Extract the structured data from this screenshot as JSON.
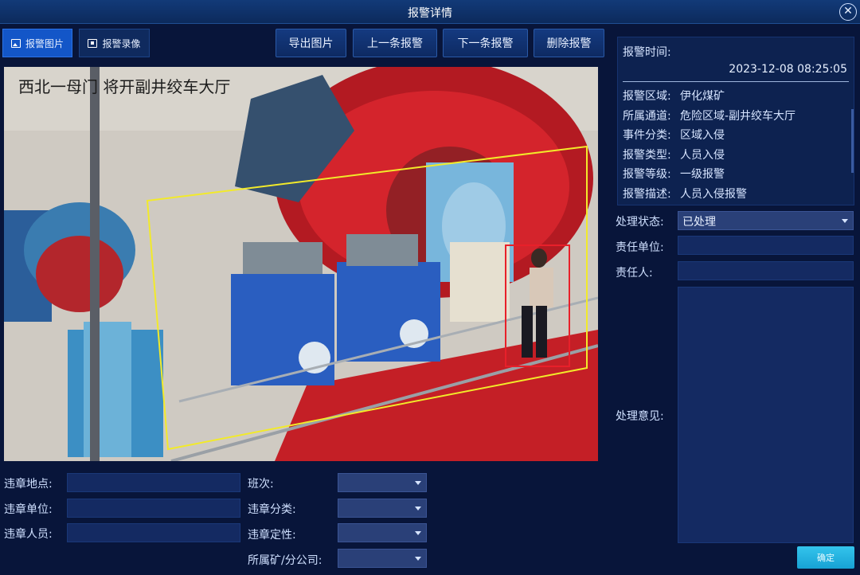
{
  "window": {
    "title": "报警详情",
    "close_icon": "close-circle-icon"
  },
  "tabs": [
    {
      "label": "报警图片",
      "icon": "image-icon",
      "active": true
    },
    {
      "label": "报警录像",
      "icon": "video-icon",
      "active": false
    }
  ],
  "toolbar": {
    "export": "导出图片",
    "prev": "上一条报警",
    "next": "下一条报警",
    "delete": "删除报警"
  },
  "photo": {
    "overlay_text": "西北一母门 将开副井绞车大厅"
  },
  "form_left": {
    "location_label": "违章地点:",
    "unit_label": "违章单位:",
    "person_label": "违章人员:",
    "location_value": "",
    "unit_value": "",
    "person_value": ""
  },
  "form_mid": {
    "shift_label": "班次:",
    "category_label": "违章分类:",
    "nature_label": "违章定性:",
    "branch_label": "所属矿/分公司:",
    "shift_value": "",
    "category_value": "",
    "nature_value": "",
    "branch_value": ""
  },
  "info": {
    "time_label": "报警时间:",
    "time_value": "2023-12-08 08:25:05",
    "rows": [
      {
        "k": "报警区域:",
        "v": "伊化煤矿"
      },
      {
        "k": "所属通道:",
        "v": "危险区域-副井绞车大厅"
      },
      {
        "k": "事件分类:",
        "v": "区域入侵"
      },
      {
        "k": "报警类型:",
        "v": "人员入侵"
      },
      {
        "k": "报警等级:",
        "v": "一级报警"
      },
      {
        "k": "报警描述:",
        "v": "人员入侵报警"
      }
    ]
  },
  "handling": {
    "status_label": "处理状态:",
    "status_value": "已处理",
    "unit_label": "责任单位:",
    "person_label": "责任人:",
    "opinion_label": "处理意见:",
    "confirm": "确定"
  },
  "colors": {
    "background": "#08153a",
    "active_tab": "#1356c8",
    "detection_zone": "#f2ea2a",
    "person_box": "#e8202a",
    "confirm": "#22b2e0"
  }
}
